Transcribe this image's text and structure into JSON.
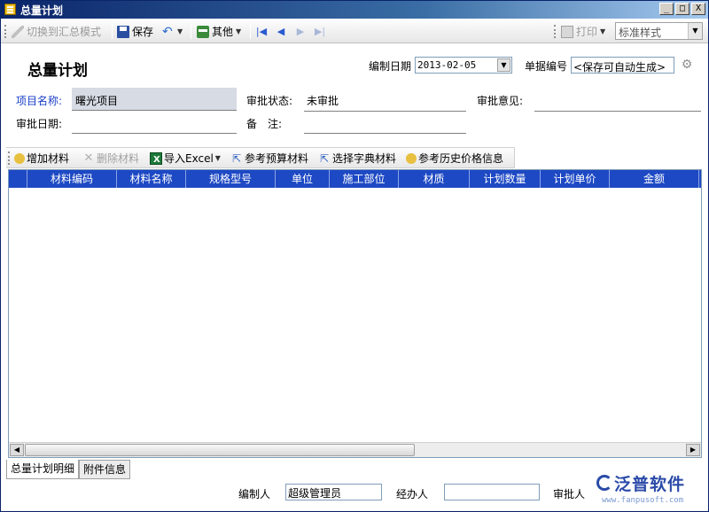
{
  "window": {
    "title": "总量计划",
    "controls": [
      "_",
      "□",
      "X"
    ]
  },
  "toolbar": {
    "switch_mode": "切换到汇总模式",
    "save": "保存",
    "other": "其他",
    "print": "打印",
    "style_value": "标准样式"
  },
  "header": {
    "page_title": "总量计划",
    "date_label": "编制日期",
    "date_value": "2013-02-05",
    "code_label": "单据编号",
    "code_value": "<保存可自动生成>"
  },
  "form": {
    "project_label": "项目名称:",
    "project_value": "曙光项目",
    "status_label": "审批状态:",
    "status_value": "未审批",
    "opinion_label": "审批意见:",
    "approve_date_label": "审批日期:",
    "remark_label": "备　注:"
  },
  "material_toolbar": {
    "add": "增加材料",
    "delete": "删除材料",
    "import": "导入Excel",
    "ref_budget": "参考预算材料",
    "select_dict": "选择字典材料",
    "ref_history": "参考历史价格信息"
  },
  "grid": {
    "columns": [
      "材料编码",
      "材料名称",
      "规格型号",
      "单位",
      "施工部位",
      "材质",
      "计划数量",
      "计划单价",
      "金额"
    ]
  },
  "tabs": [
    "总量计划明细",
    "附件信息"
  ],
  "footer": {
    "creator_label": "编制人",
    "creator_value": "超级管理员",
    "handler_label": "经办人",
    "handler_value": "",
    "approver_label": "审批人"
  },
  "watermark": {
    "brand": "泛普软件",
    "url": "www.fanpusoft.com"
  }
}
